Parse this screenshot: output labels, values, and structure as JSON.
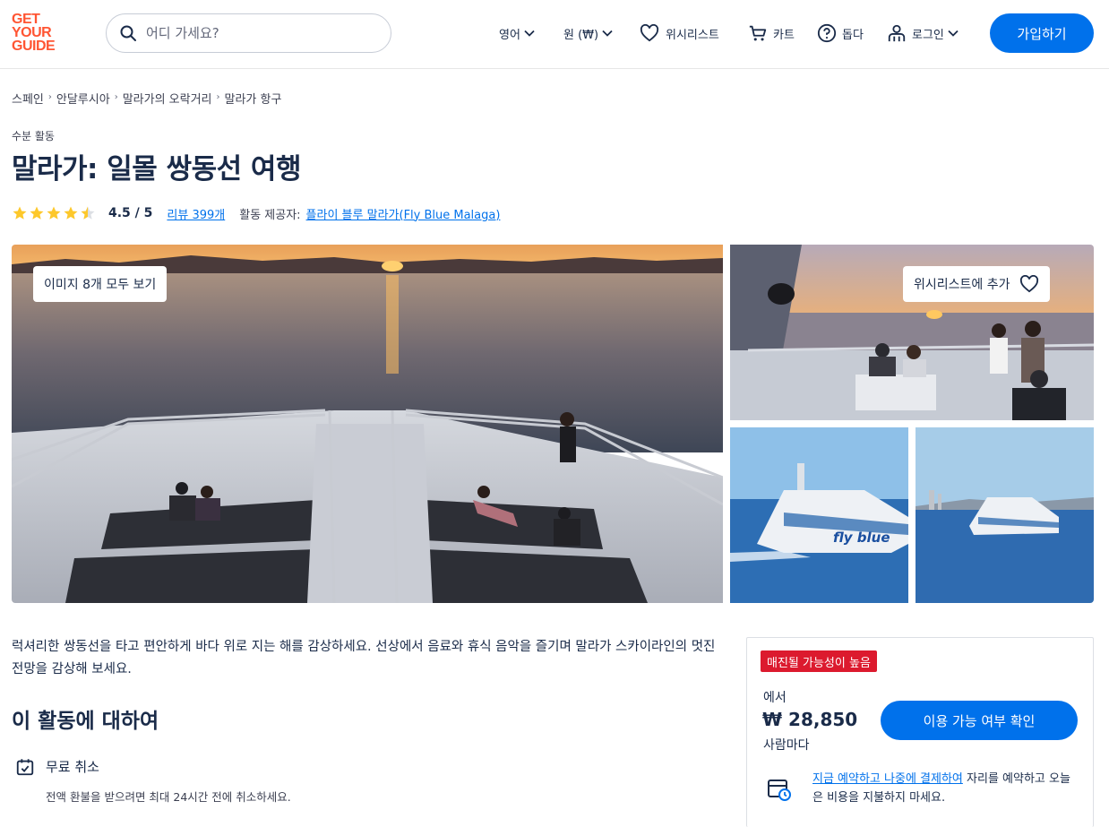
{
  "header": {
    "logo_lines": [
      "GET",
      "YOUR",
      "GUIDE"
    ],
    "search_placeholder": "어디 가세요?",
    "language": "영어",
    "currency": "원 (₩)",
    "wishlist": "위시리스트",
    "cart": "카트",
    "help": "돕다",
    "login": "로그인",
    "signup": "가입하기"
  },
  "breadcrumb": [
    "스페인",
    "안달루시아",
    "말라가의 오락거리",
    "말라가 항구"
  ],
  "category": "수분 활동",
  "title": "말라가: 일몰 쌍동선 여행",
  "rating": {
    "stars": 4.5,
    "value": "4.5 / 5",
    "reviews": "리뷰 399개",
    "provider_label": "활동 제공자:",
    "provider": "플라이 블루 말라가(Fly Blue Malaga)"
  },
  "gallery": {
    "view_all": "이미지 8개 모두 보기",
    "wishlist_add": "위시리스트에 추가",
    "boat_text": "fly blue"
  },
  "description": "럭셔리한 쌍동선을 타고 편안하게 바다 위로 지는 해를 감상하세요. 선상에서 음료와 휴식 음악을 즐기며 말라가 스카이라인의 멋진 전망을 감상해 보세요.",
  "about": {
    "title": "이 활동에 대하여",
    "features": [
      {
        "icon": "calendar-check-icon",
        "title": "무료 취소",
        "desc": "전액 환불을 받으려면 최대 24시간 전에 취소하세요."
      }
    ]
  },
  "booking": {
    "badge": "매진될 가능성이 높음",
    "from": "에서",
    "price": "₩ 28,850",
    "per": "사람마다",
    "check_button": "이용 가능 여부 확인",
    "rnpl_link": "지금 예약하고 나중에 결제하여",
    "rnpl_text": " 자리를 예약하고 오늘은 비용을 지불하지 마세요."
  },
  "colors": {
    "brand": "#ff5533",
    "primary": "#0071eb",
    "badge": "#dc1a2e",
    "text": "#1a2b49",
    "star": "#fdc82b"
  }
}
